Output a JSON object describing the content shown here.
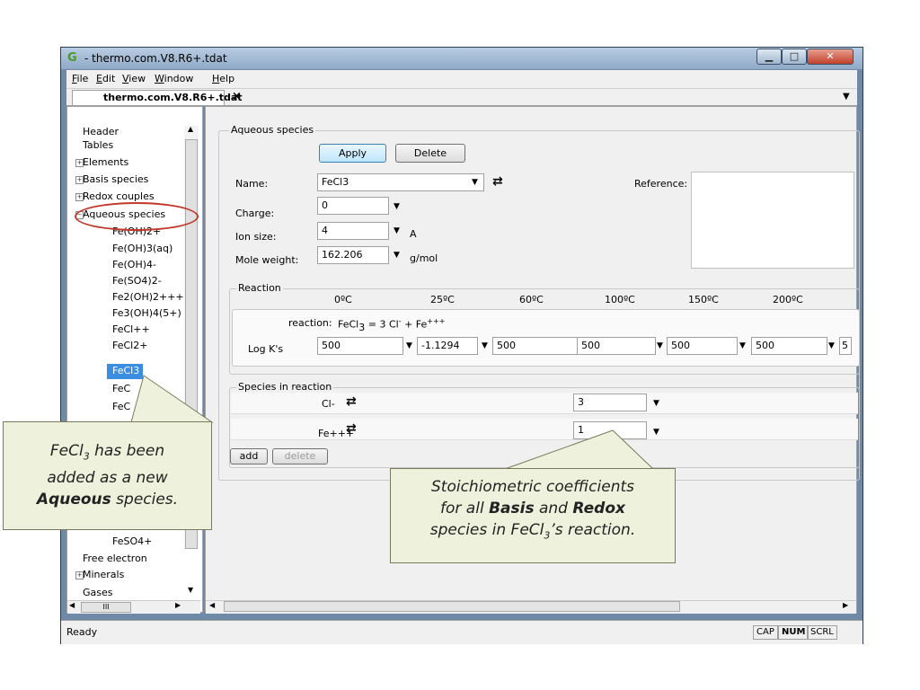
{
  "window": {
    "title": "- thermo.com.V8.R6+.tdat",
    "app_icon": "G"
  },
  "menu": [
    {
      "u": "F",
      "rest": "ile"
    },
    {
      "u": "E",
      "rest": "dit"
    },
    {
      "u": "V",
      "rest": "iew"
    },
    {
      "u": "W",
      "rest": "indow"
    },
    {
      "u": "H",
      "rest": "elp"
    }
  ],
  "tab": {
    "label": "thermo.com.V8.R6+.tdat",
    "close": "×"
  },
  "tree": {
    "items": [
      "Header",
      "Tables",
      "Elements",
      "Basis species",
      "Redox couples",
      "Aqueous species",
      "Fe(OH)2+",
      "Fe(OH)3(aq)",
      "Fe(OH)4-",
      "Fe(SO4)2-",
      "Fe2(OH)2+++",
      "Fe3(OH)4(5+)",
      "FeCl++",
      "FeCl2+",
      "FeCl3",
      "FeC",
      "FeC",
      "FeSO4+",
      "Free electron",
      "Minerals",
      "Gases"
    ],
    "selected": "FeCl3",
    "scroll_h": "III"
  },
  "aqueous": {
    "group_label": "Aqueous species",
    "apply": "Apply",
    "delete": "Delete",
    "name_label": "Name:",
    "name_value": "FeCl3",
    "charge_label": "Charge:",
    "charge_value": "0",
    "ionsize_label": "Ion size:",
    "ionsize_value": "4",
    "ionsize_unit": "A",
    "molweight_label": "Mole weight:",
    "molweight_value": "162.206",
    "molweight_unit": "g/mol",
    "reference_label": "Reference:"
  },
  "reaction": {
    "group_label": "Reaction",
    "temps": [
      "0ºC",
      "25ºC",
      "60ºC",
      "100ºC",
      "150ºC",
      "200ºC"
    ],
    "reaction_label": "reaction:",
    "reaction_lhs": "FeCl",
    "reaction_lhs_sub": "3",
    "reaction_rhs": "= 3 Cl",
    "reaction_rhs_sup": "-",
    "reaction_rhs2": " + Fe",
    "reaction_rhs2_sup": "+++",
    "logk_label": "Log K's",
    "logk": [
      "500",
      "-1.1294",
      "500",
      "500",
      "500",
      "500",
      "5"
    ]
  },
  "species_in_reaction": {
    "group_label": "Species in reaction",
    "rows": [
      {
        "name": "Cl-",
        "coef": "3"
      },
      {
        "name": "Fe+++",
        "coef": "1"
      }
    ],
    "add": "add",
    "delete": "delete"
  },
  "status": {
    "text": "Ready",
    "cap": "CAP",
    "num": "NUM",
    "scrl": "SCRL"
  },
  "callouts": {
    "left": {
      "p1": "FeCl",
      "sub": "3",
      "p2": " has been",
      "p3": "added as a new",
      "bold": "Aqueous",
      "p4": " species."
    },
    "right": {
      "p1": "Stoichiometric coefficients",
      "p2": "for all ",
      "b1": "Basis",
      "p3": " and ",
      "b2": "Redox",
      "p4": "species in FeCl",
      "sub": "3",
      "p5": "’s reaction."
    }
  }
}
